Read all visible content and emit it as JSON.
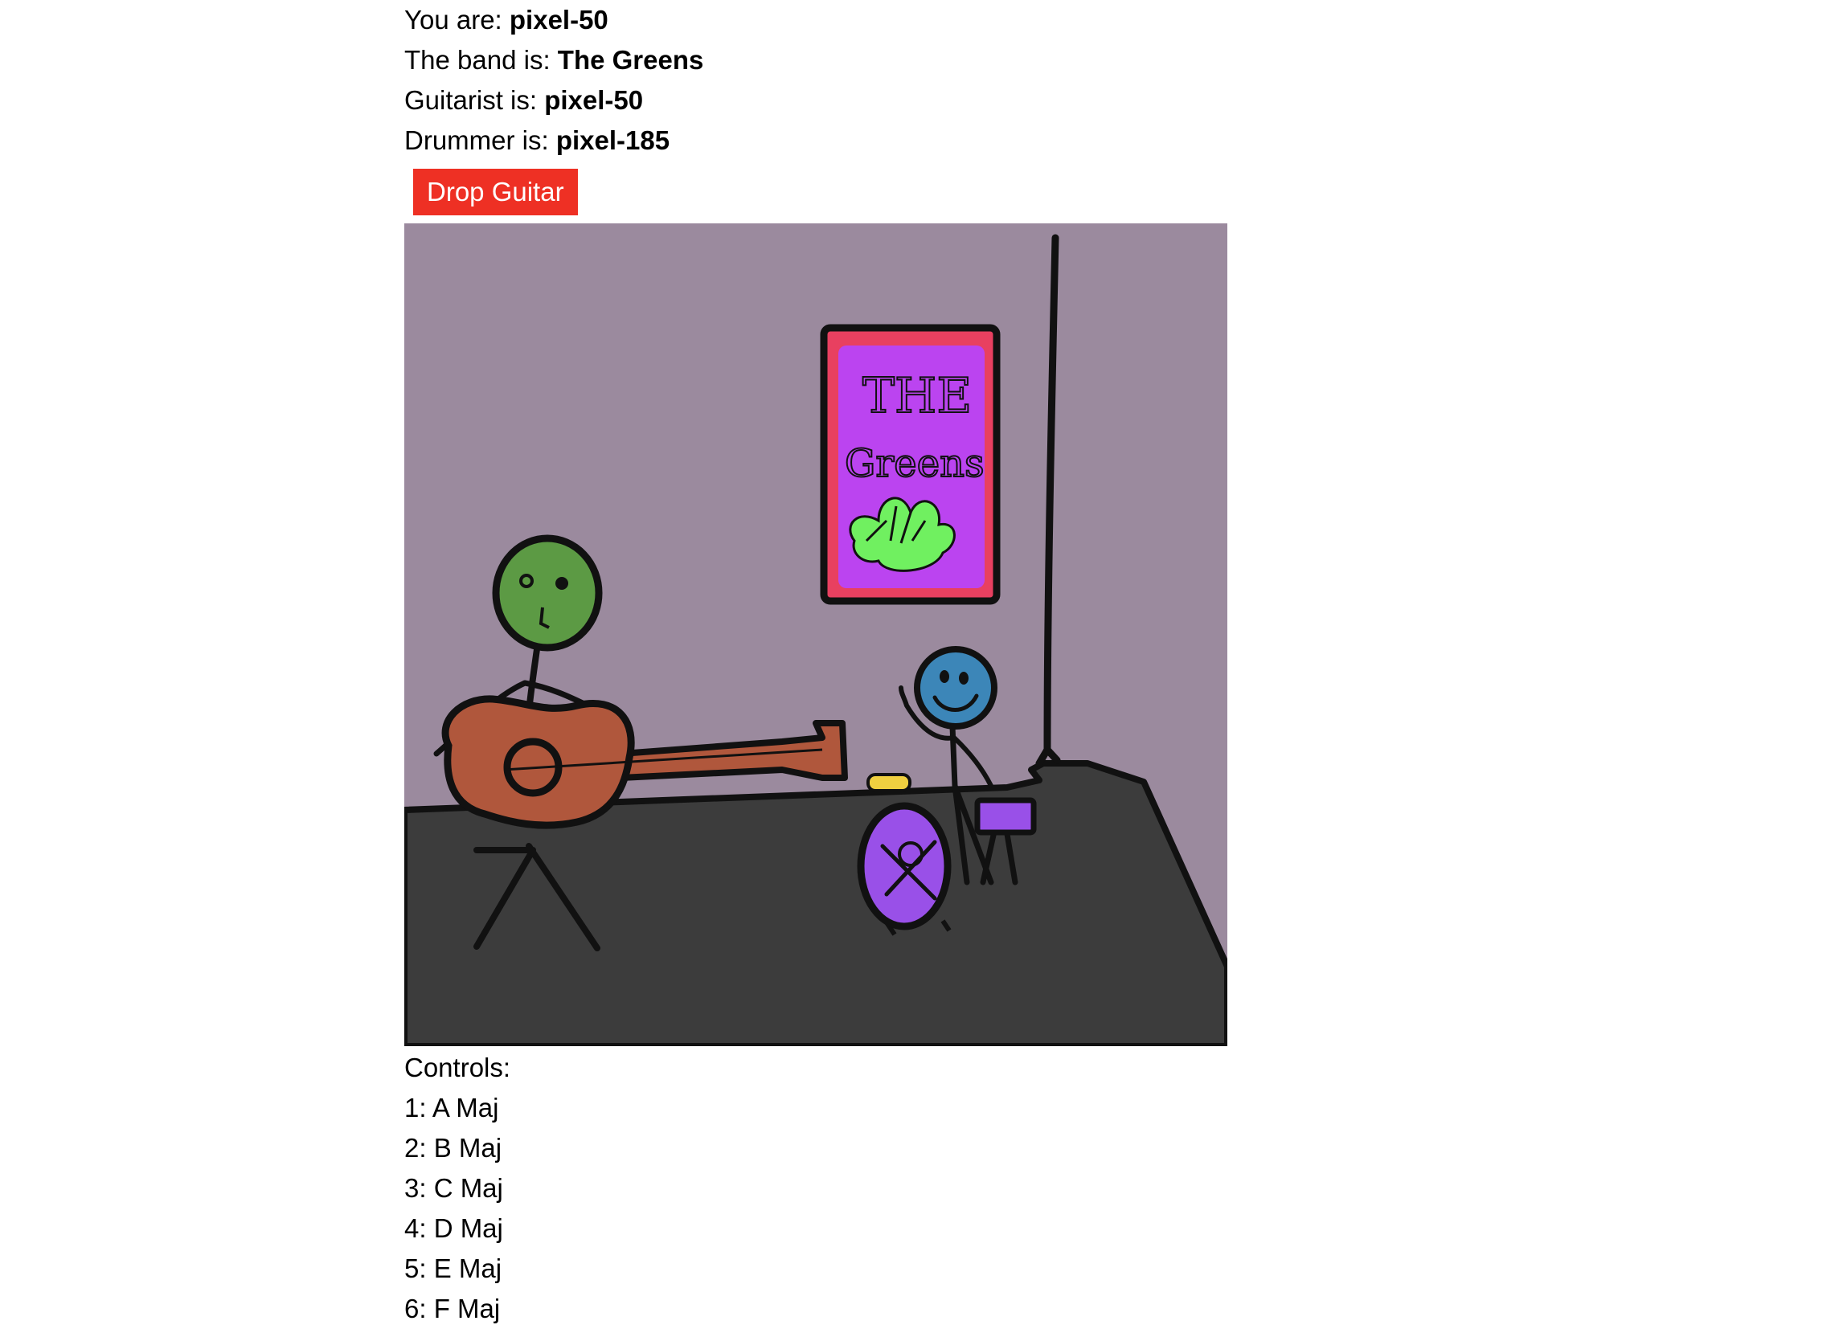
{
  "player": {
    "prefix": "You are: ",
    "name": "pixel-50"
  },
  "band": {
    "prefix": "The band is: ",
    "name": "The Greens"
  },
  "guitarist": {
    "prefix": "Guitarist is: ",
    "name": "pixel-50"
  },
  "drummer": {
    "prefix": "Drummer is: ",
    "name": "pixel-185"
  },
  "drop_button": {
    "label": "Drop Guitar"
  },
  "scene": {
    "poster_text_line1": "THE",
    "poster_text_line2": "Greens",
    "colors": {
      "wall": "#9b8a9e",
      "stage": "#3c3c3c",
      "poster_border": "#e84060",
      "poster_fill": "#bb44f0",
      "bush": "#70f060",
      "guitarist_head": "#5c9a44",
      "guitar": "#b0573c",
      "drummer_head": "#3c86b8",
      "drum": "#9950e8",
      "button": "#ee3024"
    }
  },
  "controls": {
    "heading": "Controls:",
    "items": [
      {
        "label": "1: A Maj"
      },
      {
        "label": "2: B Maj"
      },
      {
        "label": "3: C Maj"
      },
      {
        "label": "4: D Maj"
      },
      {
        "label": "5: E Maj"
      },
      {
        "label": "6: F Maj"
      }
    ]
  }
}
